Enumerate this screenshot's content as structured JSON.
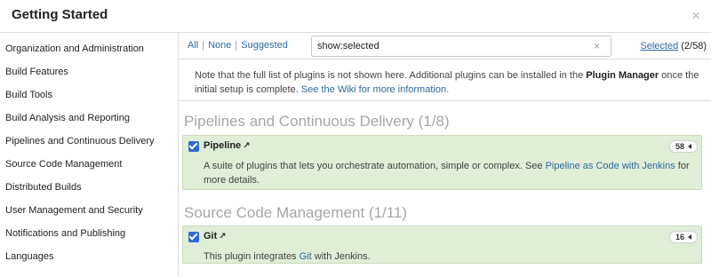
{
  "header": {
    "title": "Getting Started",
    "close": "×"
  },
  "sidebar": {
    "items": [
      {
        "label": "Organization and Administration"
      },
      {
        "label": "Build Features"
      },
      {
        "label": "Build Tools"
      },
      {
        "label": "Build Analysis and Reporting"
      },
      {
        "label": "Pipelines and Continuous Delivery"
      },
      {
        "label": "Source Code Management"
      },
      {
        "label": "Distributed Builds"
      },
      {
        "label": "User Management and Security"
      },
      {
        "label": "Notifications and Publishing"
      },
      {
        "label": "Languages"
      }
    ]
  },
  "toolbar": {
    "filter_all": "All",
    "filter_none": "None",
    "filter_suggested": "Suggested",
    "separator": "|",
    "search_value": "show:selected",
    "search_clear": "×",
    "selected_link": "Selected",
    "selected_count": "(2/58)"
  },
  "note": {
    "text_before": "Note that the full list of plugins is not shown here. Additional plugins can be installed in the ",
    "plugin_manager": "Plugin Manager",
    "text_after": " once the initial setup is complete. ",
    "wiki_link": "See the Wiki for more information."
  },
  "sections": [
    {
      "title": "Pipelines and Continuous Delivery (1/8)",
      "plugin": {
        "name": "Pipeline",
        "ext_icon": "↗",
        "count": "58",
        "desc_before": "A suite of plugins that lets you orchestrate automation, simple or complex. See ",
        "desc_link": "Pipeline as Code with Jenkins",
        "desc_after": " for more details."
      }
    },
    {
      "title": "Source Code Management (1/11)",
      "plugin": {
        "name": "Git",
        "ext_icon": "↗",
        "count": "16",
        "desc_before": "This plugin integrates ",
        "desc_link": "Git",
        "desc_after": " with Jenkins."
      }
    }
  ],
  "colors": {
    "accent_link": "#2e6aa1",
    "checkbox": "#2f6bd6",
    "plugin_bg": "#e0edd7",
    "section_title": "#a6a6a6"
  }
}
